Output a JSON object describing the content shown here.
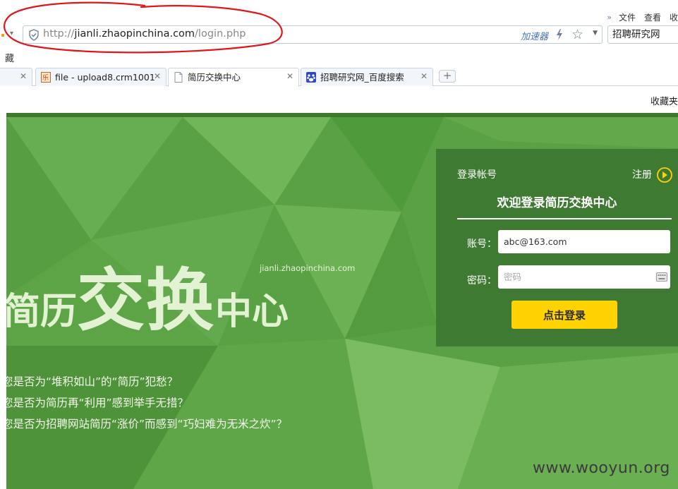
{
  "browser": {
    "menu": {
      "more": "»",
      "file": "文件",
      "view": "查看",
      "edge": "收"
    },
    "address": {
      "scheme": "http://",
      "host": "jianli.zhaopinchina.com",
      "path": "/login.php",
      "accelerator": "加速器"
    },
    "search": {
      "value": "招聘研究网"
    },
    "bookmark_edge": "藏",
    "tabs": [
      {
        "title": "",
        "active": false
      },
      {
        "title": "file - upload8.crm1001",
        "active": false
      },
      {
        "title": "简历交换中心",
        "active": true
      },
      {
        "title": "招聘研究网_百度搜索",
        "active": false
      }
    ],
    "new_tab": "+",
    "close_glyph": "✕",
    "bookmarks_right": "收藏夹"
  },
  "hero": {
    "domain": "jianli.zhaopinchina.com",
    "title_parts": [
      "简历",
      "交换",
      "中心"
    ],
    "questions": [
      "您是否为“堆积如山”的“简历”犯愁？",
      "您是否为简历再“利用”感到举手无措？",
      "您是否为招聘网站简历“涨价”而感到“巧妇难为无米之炊”？"
    ]
  },
  "login": {
    "header_label": "登录帐号",
    "register_label": "注册",
    "welcome": "欢迎登录简历交换中心",
    "account_label": "账号：",
    "account_value": "abc@163.com",
    "password_label": "密码：",
    "password_placeholder": "密码",
    "submit_label": "点击登录"
  },
  "watermark": "www.wooyun.org",
  "colors": {
    "page_green": "#5aa044",
    "panel_green": "#3e7a31",
    "button_yellow": "#ffd200",
    "annotation_red": "#e0161a"
  }
}
